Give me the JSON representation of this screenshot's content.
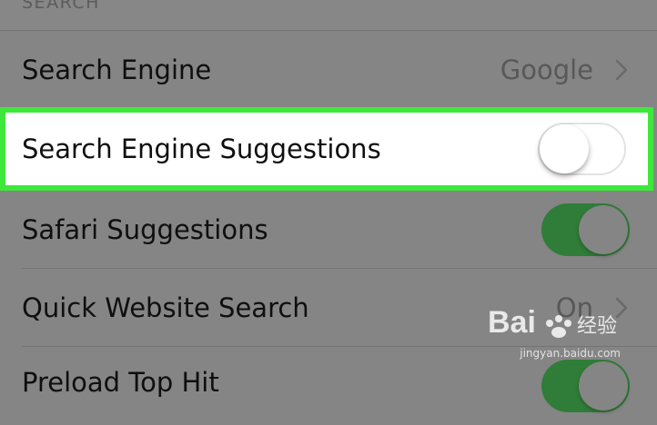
{
  "section": {
    "header": "SEARCH"
  },
  "rows": [
    {
      "label": "Search Engine",
      "value": "Google",
      "type": "disclosure"
    },
    {
      "label": "Search Engine Suggestions",
      "type": "toggle",
      "state": "off",
      "highlighted": true
    },
    {
      "label": "Safari Suggestions",
      "type": "toggle",
      "state": "on"
    },
    {
      "label": "Quick Website Search",
      "value": "On",
      "type": "disclosure"
    },
    {
      "label": "Preload Top Hit",
      "type": "toggle",
      "state": "on"
    }
  ],
  "watermark": {
    "url": "jingyan.baidu.com"
  },
  "colors": {
    "highlight_border": "#3ee83a",
    "toggle_on": "#2f7d38",
    "dim_background": "#878787"
  }
}
